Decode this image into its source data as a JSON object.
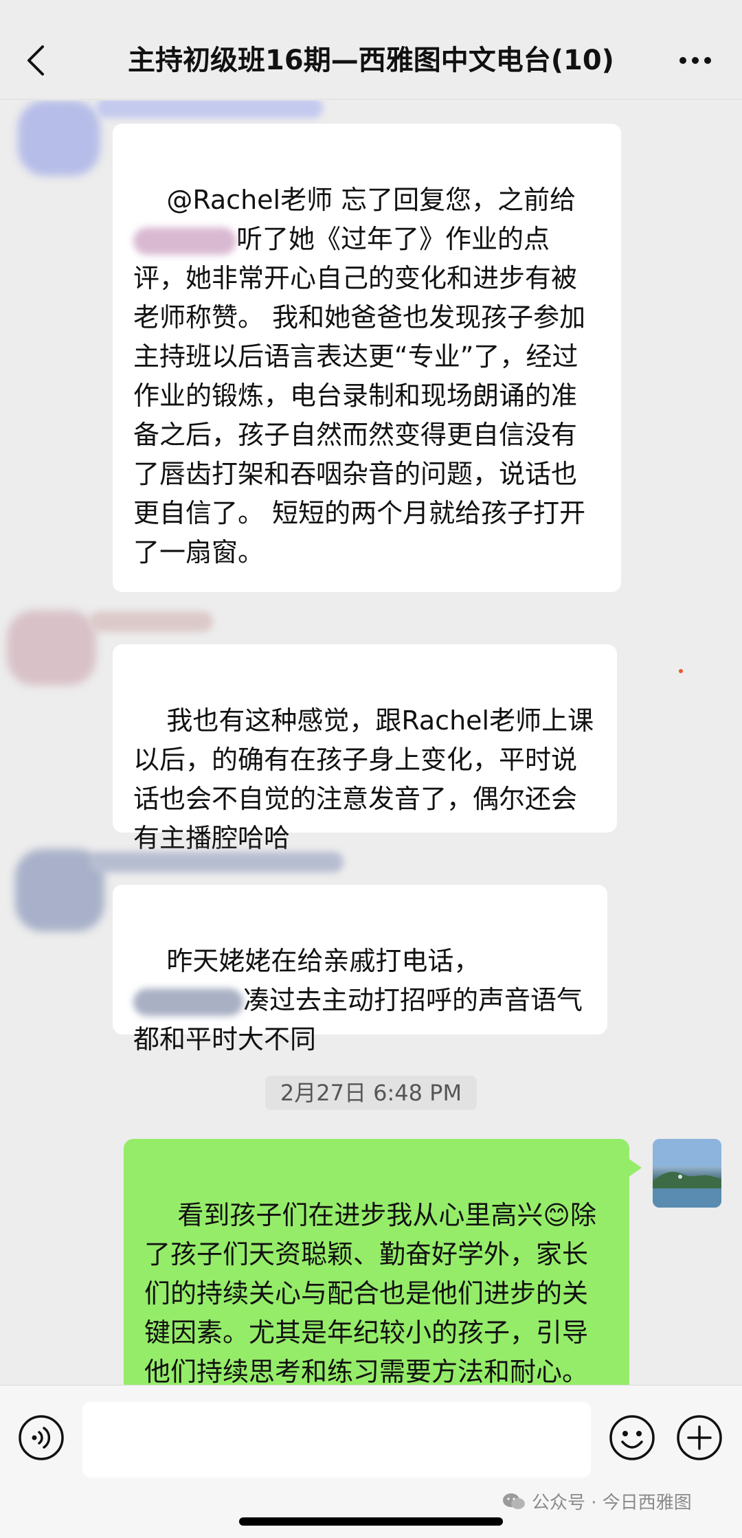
{
  "header": {
    "title": "主持初级班16期—西雅图中文电台(10)"
  },
  "messages": [
    {
      "sender": "other",
      "text_before_blur": "@Rachel老师 忘了回复您，之前给",
      "text_after_blur": "听了她《过年了》作业的点评，她非常开心自己的变化和进步有被老师称赞。 我和她爸爸也发现孩子参加主持班以后语言表达更“专业”了，经过作业的锻炼，电台录制和现场朗诵的准备之后，孩子自然而然变得更自信没有了唇齿打架和吞咽杂音的问题，说话也更自信了。 短短的两个月就给孩子打开了一扇窗。"
    },
    {
      "sender": "other",
      "text": "我也有这种感觉，跟Rachel老师上课以后，的确有在孩子身上变化，平时说话也会不自觉的注意发音了，偶尔还会有主播腔哈哈"
    },
    {
      "sender": "other",
      "text_before_blur": "昨天姥姥在给亲戚打电话，",
      "text_after_blur": "凑过去主动打招呼的声音语气都和平时大不同"
    },
    {
      "sender": "self",
      "text": "看到孩子们在进步我从心里高兴😊除了孩子们天资聪颖、勤奋好学外，家长们的持续关心与配合也是他们进步的关键因素。尤其是年纪较小的孩子，引导他们持续思考和练习需要方法和耐心。我们的家长们都"
    }
  ],
  "timestamp": "2月27日 6:48 PM",
  "input": {
    "value": ""
  },
  "watermark": {
    "text": "公众号 · 今日西雅图"
  },
  "colors": {
    "background": "#ededed",
    "bubble_other": "#ffffff",
    "bubble_self": "#95ec69",
    "input_bar": "#f6f6f6"
  }
}
